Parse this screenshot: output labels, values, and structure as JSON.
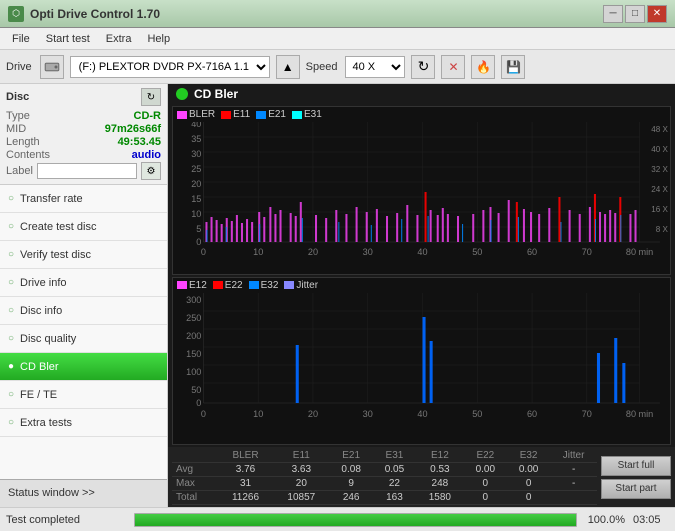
{
  "app": {
    "title": "Opti Drive Control 1.70",
    "icon": "🔵"
  },
  "titlebar": {
    "minimize_label": "─",
    "restore_label": "□",
    "close_label": "✕"
  },
  "menu": {
    "items": [
      "File",
      "Start test",
      "Extra",
      "Help"
    ]
  },
  "toolbar": {
    "drive_label": "Drive",
    "drive_value": "(F:)  PLEXTOR DVDR  PX-716A 1.11",
    "speed_label": "Speed",
    "speed_value": "40 X"
  },
  "disc": {
    "title": "Disc",
    "type_label": "Type",
    "type_value": "CD-R",
    "mid_label": "MID",
    "mid_value": "97m26s66f",
    "length_label": "Length",
    "length_value": "49:53.45",
    "contents_label": "Contents",
    "contents_value": "audio",
    "label_label": "Label",
    "label_value": ""
  },
  "nav": {
    "items": [
      {
        "id": "transfer-rate",
        "label": "Transfer rate",
        "active": false
      },
      {
        "id": "create-test-disc",
        "label": "Create test disc",
        "active": false
      },
      {
        "id": "verify-test-disc",
        "label": "Verify test disc",
        "active": false
      },
      {
        "id": "drive-info",
        "label": "Drive info",
        "active": false
      },
      {
        "id": "disc-info",
        "label": "Disc info",
        "active": false
      },
      {
        "id": "disc-quality",
        "label": "Disc quality",
        "active": false
      },
      {
        "id": "cd-bler",
        "label": "CD Bler",
        "active": true
      },
      {
        "id": "fe-te",
        "label": "FE / TE",
        "active": false
      },
      {
        "id": "extra-tests",
        "label": "Extra tests",
        "active": false
      }
    ]
  },
  "status_window_btn": "Status window >>",
  "chart": {
    "title": "CD Bler",
    "icon_color": "#22cc22",
    "top_legend": [
      {
        "label": "BLER",
        "color": "#ff44ff"
      },
      {
        "label": "E11",
        "color": "#ff0000"
      },
      {
        "label": "E21",
        "color": "#0088ff"
      },
      {
        "label": "E31",
        "color": "#00ffff"
      }
    ],
    "bottom_legend": [
      {
        "label": "E12",
        "color": "#ff44ff"
      },
      {
        "label": "E22",
        "color": "#ff0000"
      },
      {
        "label": "E32",
        "color": "#0088ff"
      },
      {
        "label": "Jitter",
        "color": "#8888ff"
      }
    ],
    "top_y_labels": [
      "48 X",
      "40 X",
      "32 X",
      "24 X",
      "16 X",
      "8 X"
    ],
    "top_y_axis": [
      "40",
      "35",
      "30",
      "25",
      "20",
      "15",
      "10",
      "5",
      "0"
    ],
    "bottom_y_axis": [
      "300",
      "250",
      "200",
      "150",
      "100",
      "50",
      "0"
    ],
    "x_axis": [
      "0",
      "10",
      "20",
      "30",
      "40",
      "50",
      "60",
      "70",
      "80 min"
    ]
  },
  "stats": {
    "headers": [
      "",
      "BLER",
      "E11",
      "E21",
      "E31",
      "E12",
      "E22",
      "E32",
      "Jitter"
    ],
    "rows": [
      {
        "label": "Avg",
        "values": [
          "3.76",
          "3.63",
          "0.08",
          "0.05",
          "0.53",
          "0.00",
          "0.00",
          "-"
        ]
      },
      {
        "label": "Max",
        "values": [
          "31",
          "20",
          "9",
          "22",
          "248",
          "0",
          "0",
          "-"
        ]
      },
      {
        "label": "Total",
        "values": [
          "11266",
          "10857",
          "246",
          "163",
          "1580",
          "0",
          "0",
          ""
        ]
      }
    ],
    "start_full_label": "Start full",
    "start_part_label": "Start part"
  },
  "status_bar": {
    "status_text": "Test completed",
    "progress_percent": 100,
    "progress_display": "100.0%",
    "time": "03:05"
  }
}
